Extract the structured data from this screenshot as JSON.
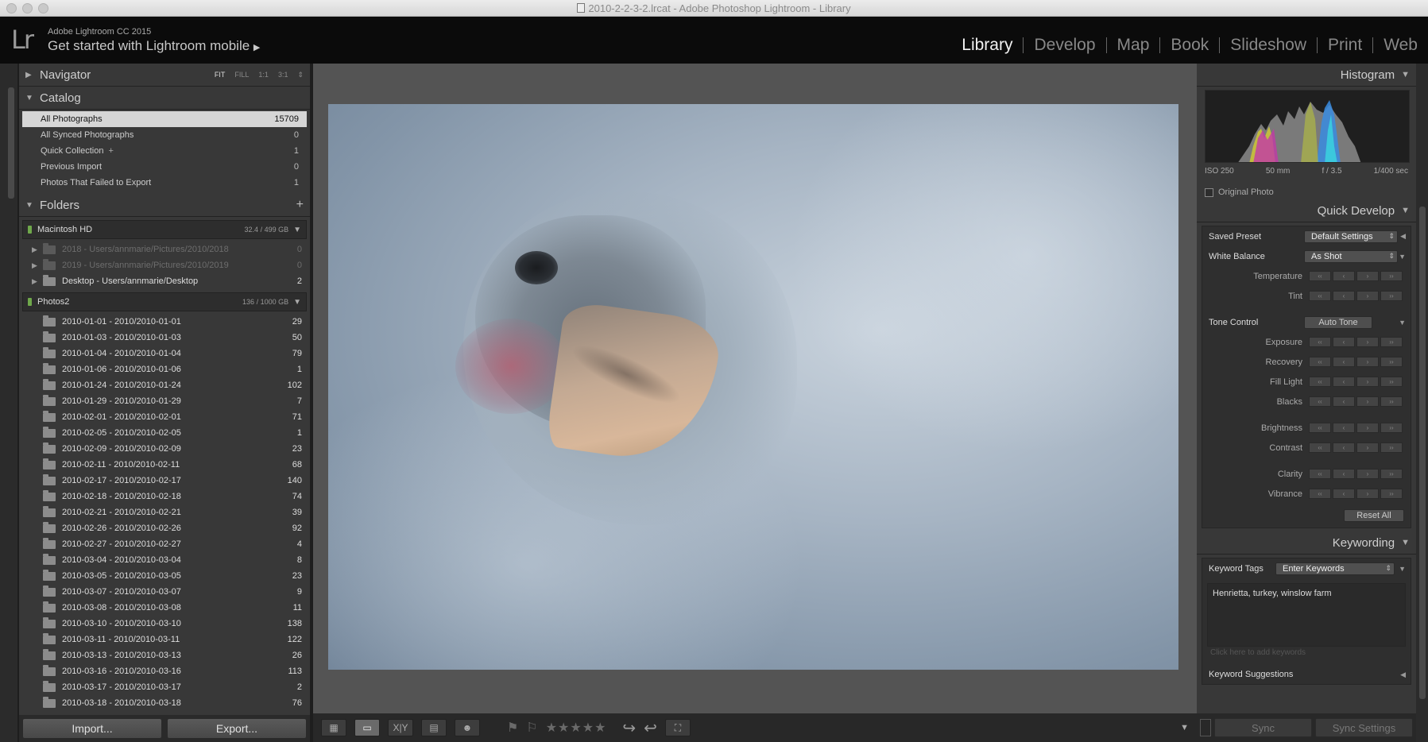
{
  "window": {
    "title": "2010-2-2-3-2.lrcat - Adobe Photoshop Lightroom - Library"
  },
  "identity": {
    "logo": "Lr",
    "product": "Adobe Lightroom CC 2015",
    "mobile_prompt": "Get started with Lightroom mobile"
  },
  "modules": [
    "Library",
    "Develop",
    "Map",
    "Book",
    "Slideshow",
    "Print",
    "Web"
  ],
  "active_module": "Library",
  "navigator": {
    "title": "Navigator",
    "opts": [
      "FIT",
      "FILL",
      "1:1",
      "3:1"
    ]
  },
  "catalog": {
    "title": "Catalog",
    "items": [
      {
        "label": "All Photographs",
        "count": "15709"
      },
      {
        "label": "All Synced Photographs",
        "count": "0"
      },
      {
        "label": "Quick Collection",
        "plus": "+",
        "count": "1"
      },
      {
        "label": "Previous Import",
        "count": "0"
      },
      {
        "label": "Photos That Failed to Export",
        "count": "1"
      }
    ]
  },
  "folders": {
    "title": "Folders",
    "add": "+",
    "volumes": [
      {
        "name": "Macintosh HD",
        "size": "32.4 / 499 GB",
        "items": [
          {
            "label": "2018 - Users/annmarie/Pictures/2010/2018",
            "count": "0",
            "dim": true
          },
          {
            "label": "2019 - Users/annmarie/Pictures/2010/2019",
            "count": "0",
            "dim": true
          },
          {
            "label": "Desktop - Users/annmarie/Desktop",
            "count": "2",
            "dim": false
          }
        ]
      },
      {
        "name": "Photos2",
        "size": "136 / 1000 GB",
        "items": [
          {
            "label": "2010-01-01 - 2010/2010-01-01",
            "count": "29"
          },
          {
            "label": "2010-01-03 - 2010/2010-01-03",
            "count": "50"
          },
          {
            "label": "2010-01-04 - 2010/2010-01-04",
            "count": "79"
          },
          {
            "label": "2010-01-06 - 2010/2010-01-06",
            "count": "1"
          },
          {
            "label": "2010-01-24 - 2010/2010-01-24",
            "count": "102"
          },
          {
            "label": "2010-01-29 - 2010/2010-01-29",
            "count": "7"
          },
          {
            "label": "2010-02-01 - 2010/2010-02-01",
            "count": "71"
          },
          {
            "label": "2010-02-05 - 2010/2010-02-05",
            "count": "1"
          },
          {
            "label": "2010-02-09 - 2010/2010-02-09",
            "count": "23"
          },
          {
            "label": "2010-02-11 - 2010/2010-02-11",
            "count": "68"
          },
          {
            "label": "2010-02-17 - 2010/2010-02-17",
            "count": "140"
          },
          {
            "label": "2010-02-18 - 2010/2010-02-18",
            "count": "74"
          },
          {
            "label": "2010-02-21 - 2010/2010-02-21",
            "count": "39"
          },
          {
            "label": "2010-02-26 - 2010/2010-02-26",
            "count": "92"
          },
          {
            "label": "2010-02-27 - 2010/2010-02-27",
            "count": "4"
          },
          {
            "label": "2010-03-04 - 2010/2010-03-04",
            "count": "8"
          },
          {
            "label": "2010-03-05 - 2010/2010-03-05",
            "count": "23"
          },
          {
            "label": "2010-03-07 - 2010/2010-03-07",
            "count": "9"
          },
          {
            "label": "2010-03-08 - 2010/2010-03-08",
            "count": "11"
          },
          {
            "label": "2010-03-10 - 2010/2010-03-10",
            "count": "138"
          },
          {
            "label": "2010-03-11 - 2010/2010-03-11",
            "count": "122"
          },
          {
            "label": "2010-03-13 - 2010/2010-03-13",
            "count": "26"
          },
          {
            "label": "2010-03-16 - 2010/2010-03-16",
            "count": "113"
          },
          {
            "label": "2010-03-17 - 2010/2010-03-17",
            "count": "2"
          },
          {
            "label": "2010-03-18 - 2010/2010-03-18",
            "count": "76"
          }
        ]
      }
    ]
  },
  "left_buttons": {
    "import": "Import...",
    "export": "Export..."
  },
  "histogram": {
    "title": "Histogram",
    "exif": {
      "iso": "ISO 250",
      "focal": "50 mm",
      "aperture": "f / 3.5",
      "shutter": "1/400 sec"
    },
    "original_photo": "Original Photo"
  },
  "quick_develop": {
    "title": "Quick Develop",
    "saved_preset_label": "Saved Preset",
    "saved_preset_value": "Default Settings",
    "white_balance_label": "White Balance",
    "white_balance_value": "As Shot",
    "wb_controls": [
      "Temperature",
      "Tint"
    ],
    "tone_control_label": "Tone Control",
    "auto_tone": "Auto Tone",
    "tone_controls_a": [
      "Exposure",
      "Recovery",
      "Fill Light",
      "Blacks"
    ],
    "tone_controls_b": [
      "Brightness",
      "Contrast"
    ],
    "tone_controls_c": [
      "Clarity",
      "Vibrance"
    ],
    "reset_all": "Reset All",
    "step_glyphs": [
      "‹‹",
      "‹",
      "›",
      "››"
    ]
  },
  "keywording": {
    "title": "Keywording",
    "tags_label": "Keyword Tags",
    "tags_select": "Enter Keywords",
    "keywords": "Henrietta, turkey, winslow farm",
    "add_placeholder": "Click here to add keywords",
    "suggestions": "Keyword Suggestions"
  },
  "sync": {
    "sync": "Sync",
    "sync_settings": "Sync Settings"
  },
  "toolbar": {
    "stars": "★★★★★"
  },
  "colors": {
    "accent": "#d6d6d6",
    "panel": "#383838",
    "background": "#545454"
  }
}
